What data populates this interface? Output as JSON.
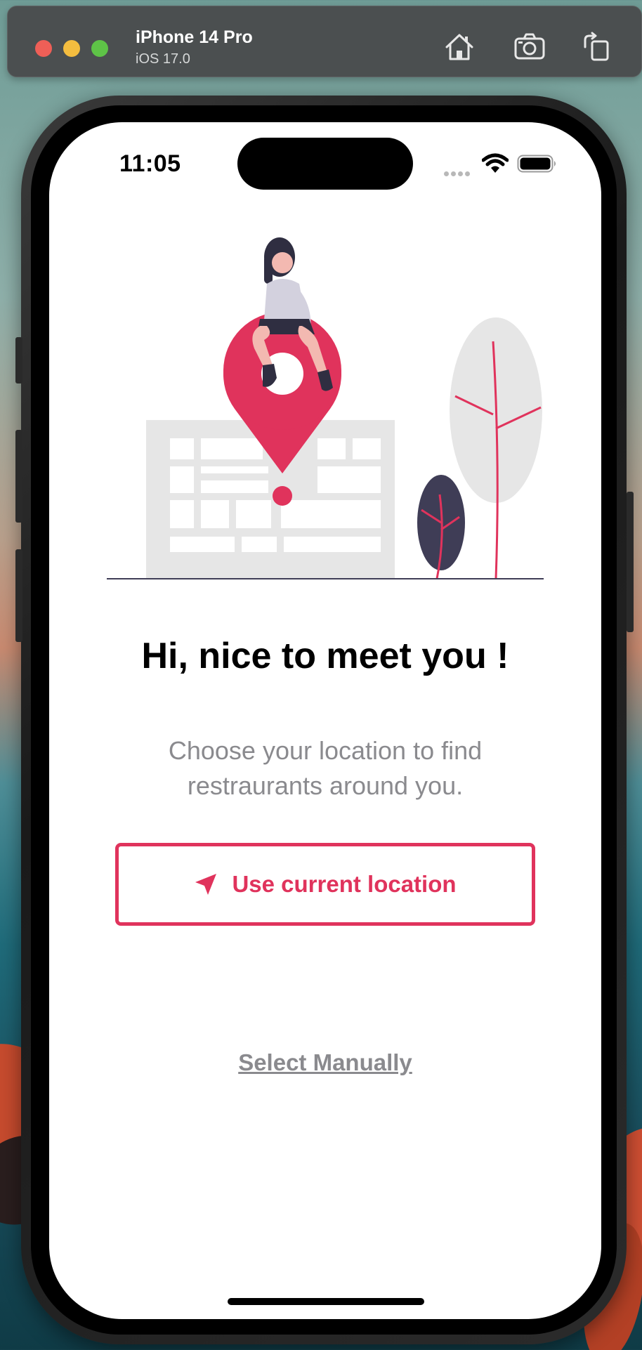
{
  "simulator": {
    "device_name": "iPhone 14 Pro",
    "os_version": "iOS 17.0",
    "buttons": [
      "home-icon",
      "screenshot-icon",
      "rotate-icon"
    ]
  },
  "status_bar": {
    "time": "11:05"
  },
  "onboarding": {
    "heading": "Hi, nice to meet you !",
    "subtitle": "Choose your location to find restraurants around you.",
    "use_location_label": "Use current location",
    "use_location_icon": "location-arrow-icon",
    "select_manually_label": "Select Manually"
  },
  "colors": {
    "accent": "#e0335c",
    "secondary_text": "#8a8a8e",
    "dark_figure": "#3f3d56",
    "illustration_gray": "#e6e6e6"
  }
}
